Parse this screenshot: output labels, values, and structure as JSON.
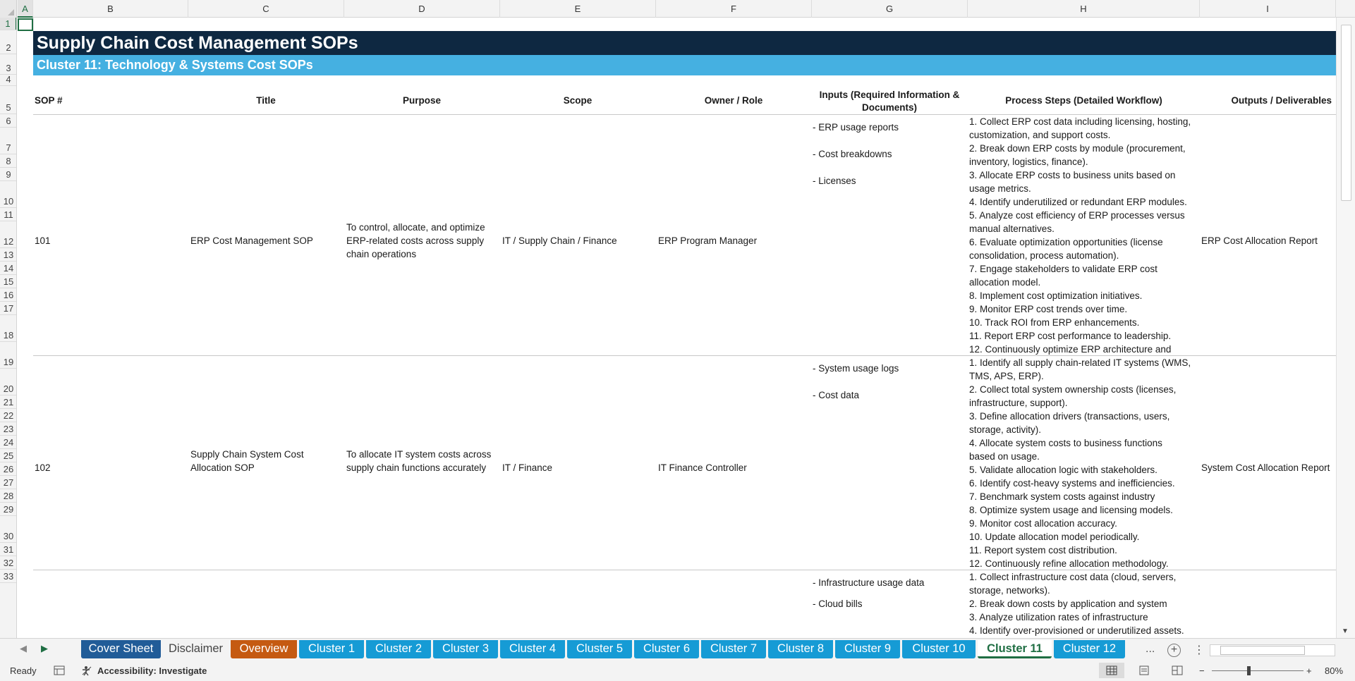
{
  "columns": [
    {
      "label": "A"
    },
    {
      "label": "B"
    },
    {
      "label": "C"
    },
    {
      "label": "D"
    },
    {
      "label": "E"
    },
    {
      "label": "F"
    },
    {
      "label": "G"
    },
    {
      "label": "H"
    },
    {
      "label": "I"
    }
  ],
  "rows": [
    "1",
    "2",
    "3",
    "4",
    "5",
    "6",
    "7",
    "8",
    "9",
    "10",
    "11",
    "12",
    "13",
    "14",
    "15",
    "16",
    "17",
    "18",
    "19",
    "20",
    "21",
    "22",
    "23",
    "24",
    "25",
    "26",
    "27",
    "28",
    "29",
    "30",
    "31",
    "32",
    "33"
  ],
  "sheet": {
    "title": "Supply Chain Cost Management SOPs",
    "cluster_title": "Cluster 11: Technology & Systems Cost SOPs",
    "headers": {
      "sop": "SOP #",
      "title": "Title",
      "purpose": "Purpose",
      "scope": "Scope",
      "owner": "Owner / Role",
      "inputs_1": "Inputs (Required Information &",
      "inputs_2": "Documents)",
      "steps": "Process Steps (Detailed Workflow)",
      "outputs": "Outputs / Deliverables"
    },
    "records": [
      {
        "sop": "101",
        "title": "ERP Cost Management SOP",
        "purpose": [
          "To control, allocate, and optimize",
          "ERP-related costs across supply",
          "chain operations"
        ],
        "scope": "IT / Supply Chain / Finance",
        "owner": "ERP Program Manager",
        "inputs": [
          "- ERP usage reports",
          "- Cost breakdowns",
          "- Licenses"
        ],
        "steps": [
          "1. Collect ERP cost data including licensing, hosting,",
          "customization, and support costs.",
          "2. Break down ERP costs by module (procurement,",
          "inventory, logistics, finance).",
          "3. Allocate ERP costs to business units based on",
          "usage metrics.",
          "4. Identify underutilized or redundant ERP modules.",
          "5. Analyze cost efficiency of ERP processes versus",
          "manual alternatives.",
          "6. Evaluate optimization opportunities (license",
          "consolidation, process automation).",
          "7. Engage stakeholders to validate ERP cost",
          "allocation model.",
          "8. Implement cost optimization initiatives.",
          "9. Monitor ERP cost trends over time.",
          "10. Track ROI from ERP enhancements.",
          "11. Report ERP cost performance to leadership.",
          "12. Continuously optimize ERP architecture and"
        ],
        "output": "ERP Cost Allocation Report"
      },
      {
        "sop": "102",
        "title": [
          "Supply Chain System Cost",
          "Allocation SOP"
        ],
        "purpose": [
          "To allocate IT system costs across",
          "supply chain functions accurately"
        ],
        "scope": "IT / Finance",
        "owner": "IT Finance Controller",
        "inputs": [
          "- System usage logs",
          "- Cost data"
        ],
        "steps": [
          "1. Identify all supply chain-related IT systems (WMS,",
          "TMS, APS, ERP).",
          "2. Collect total system ownership costs (licenses,",
          "infrastructure, support).",
          "3. Define allocation drivers (transactions, users,",
          "storage, activity).",
          "4. Allocate system costs to business functions",
          "based on usage.",
          "5. Validate allocation logic with stakeholders.",
          "6. Identify cost-heavy systems and inefficiencies.",
          "7. Benchmark system costs against industry",
          "8. Optimize system usage and licensing models.",
          "9. Monitor cost allocation accuracy.",
          "10. Update allocation model periodically.",
          "11. Report system cost distribution.",
          "12. Continuously refine allocation methodology."
        ],
        "output": "System Cost Allocation Report"
      },
      {
        "inputs": [
          "- Infrastructure usage data",
          "- Cloud bills"
        ],
        "steps": [
          "1. Collect infrastructure cost data (cloud, servers,",
          "storage, networks).",
          "2. Break down costs by application and system",
          "3. Analyze utilization rates of infrastructure",
          "4. Identify over-provisioned or underutilized assets."
        ]
      }
    ]
  },
  "tabs": [
    {
      "label": "Cover Sheet",
      "color": "#215c98"
    },
    {
      "label": "Disclaimer",
      "color": "#f3f3f3"
    },
    {
      "label": "Overview",
      "color": "#c55a11"
    },
    {
      "label": "Cluster 1",
      "color": "#169bd5"
    },
    {
      "label": "Cluster 2",
      "color": "#169bd5"
    },
    {
      "label": "Cluster 3",
      "color": "#169bd5"
    },
    {
      "label": "Cluster 4",
      "color": "#169bd5"
    },
    {
      "label": "Cluster 5",
      "color": "#169bd5"
    },
    {
      "label": "Cluster 6",
      "color": "#169bd5"
    },
    {
      "label": "Cluster 7",
      "color": "#169bd5"
    },
    {
      "label": "Cluster 8",
      "color": "#169bd5"
    },
    {
      "label": "Cluster 9",
      "color": "#169bd5"
    },
    {
      "label": "Cluster 10",
      "color": "#169bd5"
    },
    {
      "label": "Cluster 11",
      "color": "#ffffff",
      "active": true
    },
    {
      "label": "Cluster 12",
      "color": "#169bd5"
    }
  ],
  "tabbar": {
    "more": "...",
    "add": "+",
    "overflow": "⋮"
  },
  "status": {
    "ready": "Ready",
    "accessibility": "Accessibility: Investigate",
    "zoom": "80%",
    "zoom_minus": "−",
    "zoom_plus": "+"
  }
}
